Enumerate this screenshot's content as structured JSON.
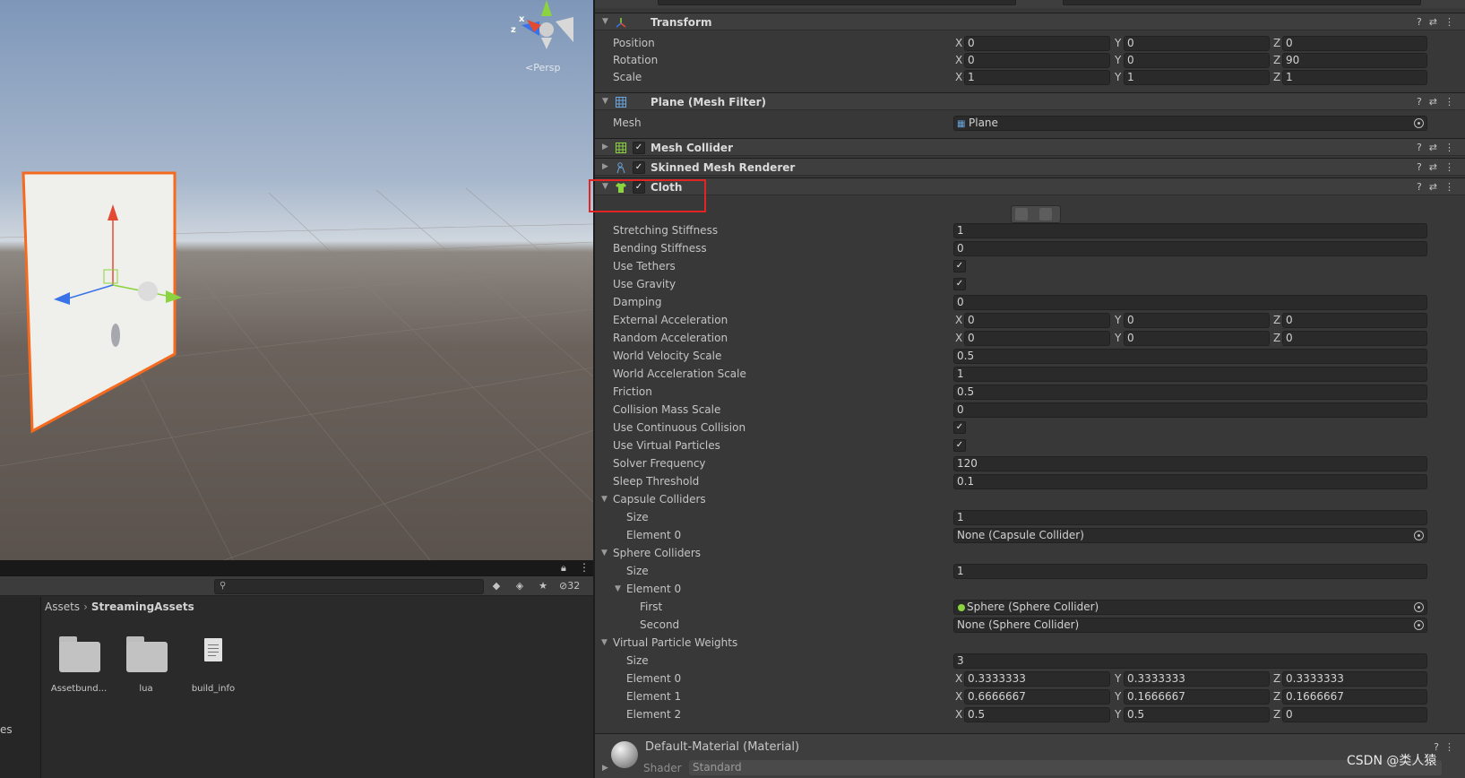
{
  "scene": {
    "persp_label": "<Persp",
    "gizmo_axes": [
      "x",
      "z"
    ],
    "colors": {
      "x": "#e24a32",
      "y": "#8bd33f",
      "z": "#3a73e8",
      "selection": "#f56a1e"
    }
  },
  "project": {
    "hidden_count": "32",
    "left_cut_label": "es",
    "breadcrumb": {
      "root": "Assets",
      "current": "StreamingAssets"
    },
    "assets": [
      {
        "name": "Assetbund...",
        "icon": "folder-icon"
      },
      {
        "name": "lua",
        "icon": "folder-icon"
      },
      {
        "name": "build_info",
        "icon": "text-file-icon"
      }
    ]
  },
  "inspector": {
    "transform": {
      "title": "Transform",
      "rows": [
        {
          "label": "Position",
          "x": "0",
          "y": "0",
          "z": "0"
        },
        {
          "label": "Rotation",
          "x": "0",
          "y": "0",
          "z": "90"
        },
        {
          "label": "Scale",
          "x": "1",
          "y": "1",
          "z": "1"
        }
      ]
    },
    "mesh_filter": {
      "title": "Plane (Mesh Filter)",
      "mesh_label": "Mesh",
      "mesh_value": "Plane"
    },
    "mesh_collider": {
      "title": "Mesh Collider"
    },
    "skinned_mesh_renderer": {
      "title": "Skinned Mesh Renderer"
    },
    "cloth": {
      "title": "Cloth",
      "stretching_stiffness": {
        "label": "Stretching Stiffness",
        "value": "1"
      },
      "bending_stiffness": {
        "label": "Bending Stiffness",
        "value": "0"
      },
      "use_tethers": {
        "label": "Use Tethers",
        "checked": true
      },
      "use_gravity": {
        "label": "Use Gravity",
        "checked": true
      },
      "damping": {
        "label": "Damping",
        "value": "0"
      },
      "external_acceleration": {
        "label": "External Acceleration",
        "x": "0",
        "y": "0",
        "z": "0"
      },
      "random_acceleration": {
        "label": "Random Acceleration",
        "x": "0",
        "y": "0",
        "z": "0"
      },
      "world_velocity_scale": {
        "label": "World Velocity Scale",
        "value": "0.5"
      },
      "world_acceleration_scale": {
        "label": "World Acceleration Scale",
        "value": "1"
      },
      "friction": {
        "label": "Friction",
        "value": "0.5"
      },
      "collision_mass_scale": {
        "label": "Collision Mass Scale",
        "value": "0"
      },
      "use_continuous_collision": {
        "label": "Use Continuous Collision",
        "checked": true
      },
      "use_virtual_particles": {
        "label": "Use Virtual Particles",
        "checked": true
      },
      "solver_frequency": {
        "label": "Solver Frequency",
        "value": "120"
      },
      "sleep_threshold": {
        "label": "Sleep Threshold",
        "value": "0.1"
      },
      "capsule_colliders": {
        "label": "Capsule Colliders",
        "size_label": "Size",
        "size": "1",
        "element0_label": "Element 0",
        "element0": "None (Capsule Collider)"
      },
      "sphere_colliders": {
        "label": "Sphere Colliders",
        "size_label": "Size",
        "size": "1",
        "element0_label": "Element 0",
        "first_label": "First",
        "first": "Sphere (Sphere Collider)",
        "second_label": "Second",
        "second": "None (Sphere Collider)"
      },
      "virtual_particle_weights": {
        "label": "Virtual Particle Weights",
        "size_label": "Size",
        "size": "3",
        "elements": [
          {
            "label": "Element 0",
            "x": "0.3333333",
            "y": "0.3333333",
            "z": "0.3333333"
          },
          {
            "label": "Element 1",
            "x": "0.6666667",
            "y": "0.1666667",
            "z": "0.1666667"
          },
          {
            "label": "Element 2",
            "x": "0.5",
            "y": "0.5",
            "z": "0"
          }
        ]
      }
    },
    "material": {
      "title": "Default-Material (Material)",
      "shader_label": "Shader",
      "shader_value": "Standard"
    },
    "axis_labels": {
      "x": "X",
      "y": "Y",
      "z": "Z"
    }
  },
  "watermark": "CSDN @类人猿"
}
